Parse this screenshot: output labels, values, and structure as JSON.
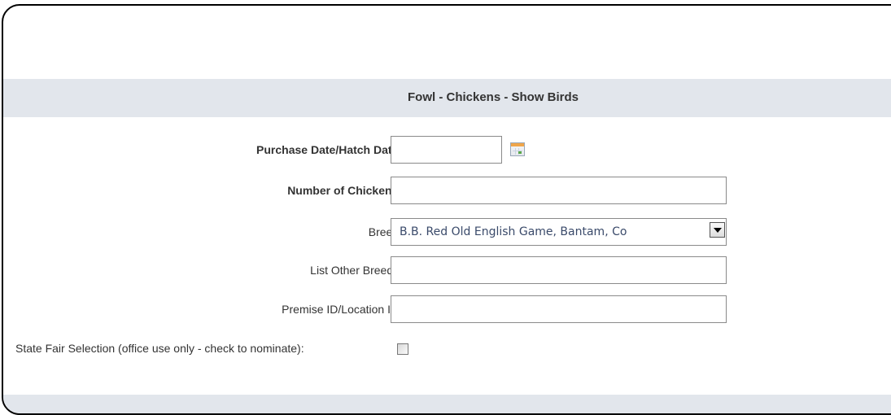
{
  "form": {
    "title": "Fowl - Chickens - Show Birds",
    "fields": {
      "purchase_date": {
        "label": "Purchase Date/Hatch Date:",
        "value": ""
      },
      "number_of_chickens": {
        "label": "Number of Chickens:",
        "value": ""
      },
      "breed": {
        "label": "Breed:",
        "selected": "B.B. Red Old English Game, Bantam, Co"
      },
      "other_breeds": {
        "label": "List Other Breeds:",
        "value": ""
      },
      "premise_id": {
        "label": "Premise ID/Location ID:",
        "value": ""
      },
      "state_fair": {
        "label": "State Fair Selection (office use only - check to nominate):",
        "checked": false
      }
    }
  },
  "icons": {
    "calendar": "calendar-icon",
    "dropdown": "chevron-down-icon"
  },
  "colors": {
    "header_bg": "#e2e6ec",
    "label_text": "#333333",
    "select_text": "#3a4a6a",
    "border": "#8a8a8a"
  }
}
